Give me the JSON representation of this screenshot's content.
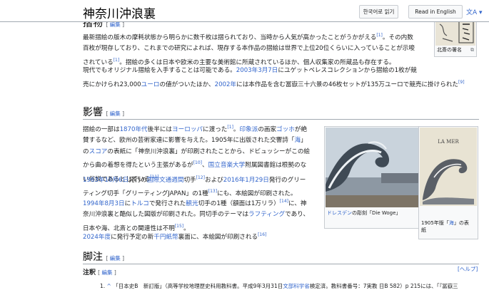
{
  "header": {
    "title": "神奈川沖浪裏",
    "btn_korean": "한국어로 읽기",
    "btn_english": "Read in English",
    "lang_icon": "文A"
  },
  "edit_label": "編集",
  "sections": {
    "s1": {
      "heading": "摺物",
      "p1_lines": [
        "最新摺絵の版木の摩耗状態から明らかに数千枚は摺られており、当時から人気が高かったことがうかがえる",
        "百枚が現存しており、これまでの研究によれば、現存する本作品の摺絵は世界で上位20位くらいに入っていることが示唆",
        "されている",
        "。摺絵の多くは日本や欧米の主要な美術館に所蔵されているほか、個人収集家の所蔵品も存在する。"
      ],
      "p1_tail": "。その内数",
      "p2_lines": [
        "現代でもオリジナル摺絵を入手することは可能である。",
        "2003年3月7日",
        "にユゲットベレスコレクションから摺絵の1枚が競",
        "売にかけられ23,000",
        "ユーロ",
        "の値がついたほか、",
        "2002年",
        "には本作品を含む冨嶽三十六景の46枚セットが135万ユーロで競売に掛けられた"
      ],
      "refs": [
        "[1]",
        "[1]",
        "[9]"
      ],
      "thumb_caption": "北斎の署名"
    },
    "s2": {
      "heading": "影響",
      "p1_lines": [
        "摺絵の一部は",
        "1870年代",
        "後半には",
        "ヨーロッパ",
        "に渡った",
        "。",
        "印象派",
        "の画家",
        "ゴッホ",
        "が絶",
        "賛するなど、欧州の芸術家達に影響を与えた。1905年に出版された交響詩「",
        "海",
        "」",
        "の",
        "スコア",
        "の表紙に「神奈川沖浪裏」が印刷されたことから、ドビュッシーがこの絵",
        "から曲の着想を得たという主張があるが",
        "、",
        "国立音楽大学",
        "附属図書館は根拠のな",
        "い俗説であるとしている"
      ],
      "p2_lines": [
        "1963年10月6日",
        "発行の",
        "国際文通週間",
        "切手",
        "および",
        "2016年1月29日",
        "発行のグリー",
        "ティング切手「グリーティングJAPAN」の1種",
        "にも、本絵図が印刷された。"
      ],
      "p3_lines": [
        "1994年8月3日",
        "に",
        "トルコ",
        "で発行された",
        "観光",
        "切手の1種（額面は1万リラ）",
        "に、神",
        "奈川沖浪裏と酷似した図版が印刷された。同切手のテーマは",
        "ラフティング",
        "であり、",
        "日本や海、北斎との関連性は不明",
        "。"
      ],
      "p4_lines": [
        "2024年度",
        "に発行予定の新",
        "千円紙幣",
        "裏面に、本絵図が印刷される"
      ],
      "refs": [
        "[1]",
        "[10]",
        "[11]",
        "[12]",
        "[13]",
        "[14]",
        "[15]",
        "[16]"
      ],
      "fig1_caption_link": "ドレスデン",
      "fig1_caption_text": "の彫刻「Die Woge」",
      "fig2_caption_a": "1905年版「",
      "fig2_caption_link": "海",
      "fig2_caption_b": "」の表",
      "fig2_caption_c": "紙",
      "fig2_cover_text": "LA MER"
    },
    "s3": {
      "heading": "脚注",
      "subheading": "注釈",
      "help_link": "[ヘルプ]",
      "note1_marker": "1.",
      "note1_arrow": "^",
      "note1_text": "「日本史B　新訂版」（高等学校地理歴史科用教科書。平成9年3月31日",
      "note1_link": "文部科学省",
      "note1_text2": "検定済。教科書番号：7実教 日B 582）p 215には、「『冨嶽三"
    }
  },
  "colors": {
    "link": "#3366cc",
    "rule": "#a2a9b1"
  }
}
